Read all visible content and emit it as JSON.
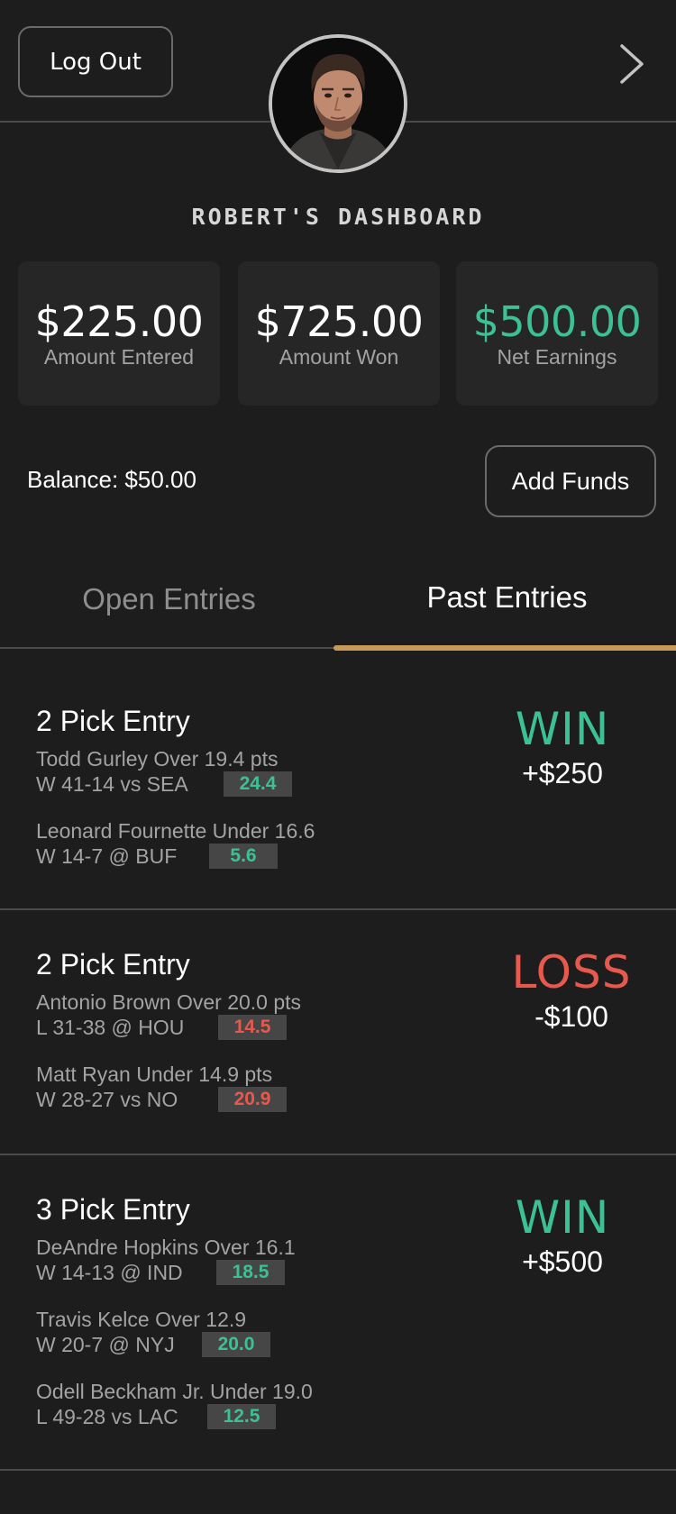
{
  "header": {
    "logout_label": "Log Out",
    "dashboard_title": "ROBERT'S DASHBOARD"
  },
  "stats": [
    {
      "amount": "$225.00",
      "label": "Amount Entered"
    },
    {
      "amount": "$725.00",
      "label": "Amount Won"
    },
    {
      "amount": "$500.00",
      "label": "Net Earnings"
    }
  ],
  "balance": {
    "text": "Balance: $50.00",
    "add_funds_label": "Add Funds"
  },
  "tabs": {
    "open": "Open Entries",
    "past": "Past Entries",
    "active": "past"
  },
  "entries": [
    {
      "title": "2 Pick Entry",
      "result": "WIN",
      "amount": "+$250",
      "picks": [
        {
          "player": "Todd Gurley Over 19.4 pts",
          "game": "W 41-14 vs SEA",
          "score": "24.4"
        },
        {
          "player": "Leonard Fournette Under 16.6",
          "game": "W 14-7 @ BUF",
          "score": "5.6"
        }
      ]
    },
    {
      "title": "2 Pick Entry",
      "result": "LOSS",
      "amount": "-$100",
      "picks": [
        {
          "player": "Antonio Brown Over 20.0 pts",
          "game": "L 31-38 @ HOU",
          "score": "14.5"
        },
        {
          "player": "Matt Ryan Under 14.9 pts",
          "game": "W 28-27 vs NO",
          "score": "20.9"
        }
      ]
    },
    {
      "title": "3 Pick Entry",
      "result": "WIN",
      "amount": "+$500",
      "picks": [
        {
          "player": "DeAndre Hopkins Over 16.1",
          "game": "W 14-13 @ IND",
          "score": "18.5"
        },
        {
          "player": "Travis Kelce Over 12.9",
          "game": "W 20-7 @ NYJ",
          "score": "20.0"
        },
        {
          "player": "Odell Beckham Jr. Under 19.0",
          "game": "L 49-28 vs LAC",
          "score": "12.5"
        }
      ]
    }
  ],
  "colors": {
    "accent": "#c79a5a",
    "win": "#3cc195",
    "loss": "#e8594d",
    "background": "#1d1d1d"
  }
}
